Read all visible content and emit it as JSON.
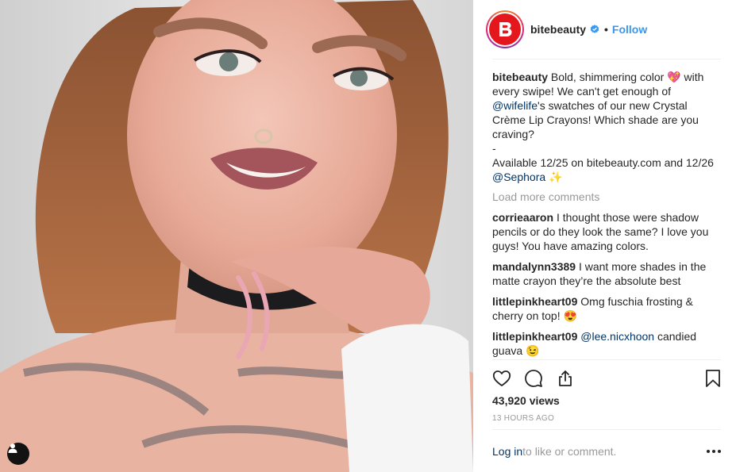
{
  "post": {
    "username": "bitebeauty",
    "separator": "•",
    "follow_label": "Follow",
    "avatar_letter": "B"
  },
  "caption": {
    "username": "bitebeauty",
    "line1": "Bold, shimmering color 💖 with every swipe! We can't get enough of ",
    "mention1": "@wifelife",
    "line2": "'s swatches of our new Crystal Crème Lip Crayons! Which shade are you craving?",
    "dash": "-",
    "line3": "Available 12/25 on bitebeauty.com and 12/26 ",
    "mention2": "@Sephora",
    "line3_end": " ✨"
  },
  "load_more_label": "Load more comments",
  "comments": [
    {
      "user": "corrieaaron",
      "text": "I thought those were shadow pencils or do they look the same? I love you guys! You have amazing colors."
    },
    {
      "user": "mandalynn3389",
      "text": "I want more shades in the matte crayon they’re the absolute best"
    },
    {
      "user": "littlepinkheart09",
      "text": "Omg fuschia frosting & cherry on top! 😍"
    },
    {
      "user": "littlepinkheart09",
      "mention": "@lee.nicxhoon",
      "text": " candied guava 😉"
    }
  ],
  "stats": {
    "views": "43,920 views",
    "time": "13 HOURS AGO"
  },
  "footer": {
    "login_label": "Log in",
    "login_rest": " to like or comment."
  },
  "icons": [
    "user-tag-icon",
    "verified-badge-icon",
    "heart-icon",
    "comment-icon",
    "share-icon",
    "bookmark-icon",
    "more-options-icon"
  ],
  "colors": {
    "brand_red": "#e3171c",
    "link_blue": "#3897f0",
    "mention_blue": "#003569"
  }
}
